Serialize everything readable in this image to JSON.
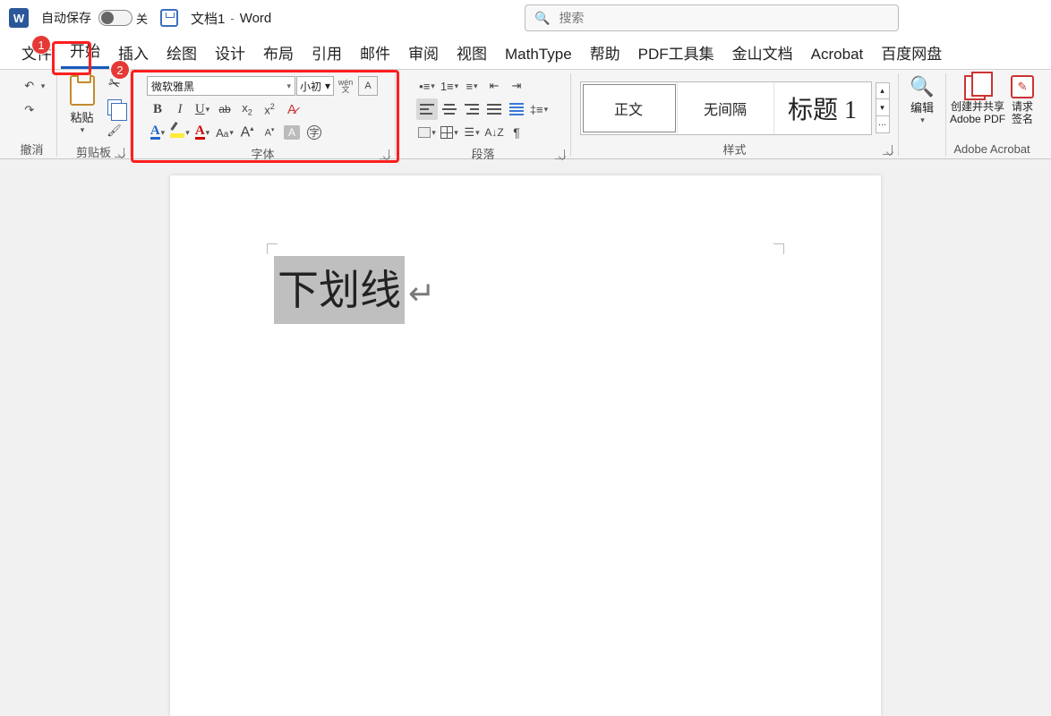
{
  "titlebar": {
    "autosave_label": "自动保存",
    "toggle_state": "关",
    "doc_name": "文档1",
    "separator": "-",
    "app_name": "Word",
    "search_placeholder": "搜索"
  },
  "tabs": [
    {
      "id": "file",
      "label": "文件"
    },
    {
      "id": "home",
      "label": "开始",
      "active": true
    },
    {
      "id": "insert",
      "label": "插入"
    },
    {
      "id": "draw",
      "label": "绘图"
    },
    {
      "id": "design",
      "label": "设计"
    },
    {
      "id": "layout",
      "label": "布局"
    },
    {
      "id": "ref",
      "label": "引用"
    },
    {
      "id": "mail",
      "label": "邮件"
    },
    {
      "id": "review",
      "label": "审阅"
    },
    {
      "id": "view",
      "label": "视图"
    },
    {
      "id": "mathtype",
      "label": "MathType"
    },
    {
      "id": "help",
      "label": "帮助"
    },
    {
      "id": "pdftools",
      "label": "PDF工具集"
    },
    {
      "id": "kingsoft",
      "label": "金山文档"
    },
    {
      "id": "acrobat",
      "label": "Acrobat"
    },
    {
      "id": "baidu",
      "label": "百度网盘"
    }
  ],
  "ribbon": {
    "undo_group": "撤消",
    "clipboard_group": "剪贴板",
    "paste_label": "粘贴",
    "font_group": "字体",
    "font_name": "微软雅黑",
    "font_size": "小初",
    "paragraph_group": "段落",
    "styles_group": "样式",
    "edit_group": "编辑",
    "acrobat_group": "Adobe Acrobat",
    "pdf_label_line1": "创建并共享",
    "pdf_label_line2": "Adobe PDF",
    "sign_label_line1": "请求",
    "sign_label_line2": "签名"
  },
  "styles": [
    {
      "id": "normal",
      "label": "正文",
      "selected": true
    },
    {
      "id": "nospace",
      "label": "无间隔"
    },
    {
      "id": "heading1",
      "label": "标题 1",
      "heading": true
    }
  ],
  "annotations": {
    "badge1": "1",
    "badge2": "2"
  },
  "document": {
    "selected_text": "下划线",
    "paragraph_mark": "↵"
  }
}
